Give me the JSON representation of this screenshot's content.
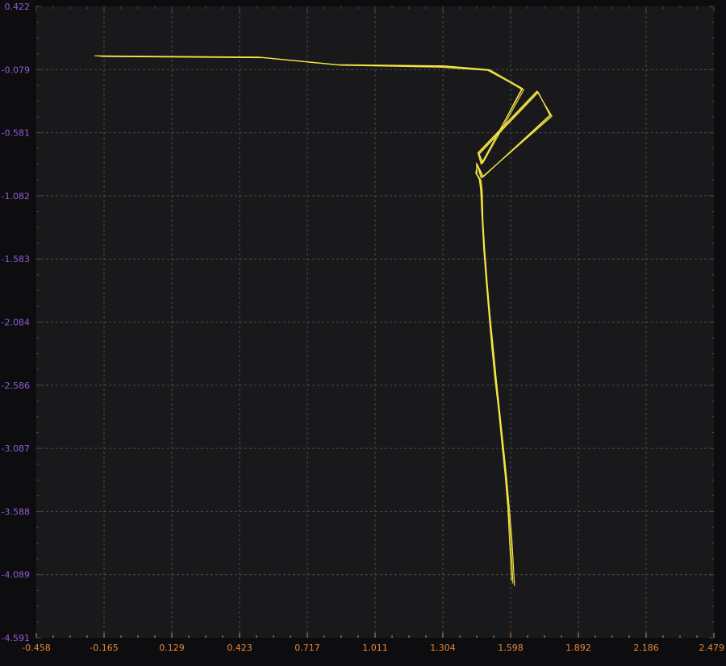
{
  "chart_data": {
    "type": "line",
    "title": "",
    "xlabel": "",
    "ylabel": "",
    "xlim": [
      -0.458,
      2.479
    ],
    "ylim": [
      -4.591,
      0.422
    ],
    "xticks": [
      "-0.458",
      "-0.165",
      "0.129",
      "0.423",
      "0.717",
      "1.011",
      "1.304",
      "1.598",
      "1.892",
      "2.186",
      "2.479"
    ],
    "yticks": [
      "0.422",
      "-0.079",
      "-0.581",
      "-1.082",
      "-1.583",
      "-2.084",
      "-2.586",
      "-3.087",
      "-3.588",
      "-4.089",
      "-4.591"
    ],
    "grid": true,
    "series": [
      {
        "x": [
          1.615,
          1.61,
          1.604,
          1.594,
          1.581,
          1.567,
          1.552,
          1.537,
          1.523,
          1.509,
          1.497,
          1.486,
          1.478,
          1.475,
          1.47,
          1.452,
          1.45,
          1.47,
          1.777,
          1.712,
          1.456,
          1.47,
          1.65,
          1.506,
          1.31,
          0.844,
          0.504,
          -0.206
        ],
        "y": [
          -4.18,
          -4.03,
          -3.82,
          -3.6,
          -3.33,
          -3.08,
          -2.82,
          -2.56,
          -2.3,
          -2.04,
          -1.78,
          -1.52,
          -1.28,
          -1.05,
          -0.96,
          -0.91,
          -0.82,
          -0.94,
          -0.45,
          -0.25,
          -0.74,
          -0.83,
          -0.23,
          -0.08,
          -0.05,
          -0.04,
          0.02,
          0.03
        ],
        "color": "#f5e642"
      },
      {
        "x": [
          1.602,
          1.598,
          1.592,
          1.586,
          1.574,
          1.56,
          1.546,
          1.53,
          1.516,
          1.504,
          1.492,
          1.481,
          1.474,
          1.468,
          1.462,
          1.447,
          1.454,
          1.48,
          1.768,
          1.718,
          1.462,
          1.478,
          1.655,
          1.498,
          1.295,
          0.862,
          0.525,
          -0.18
        ],
        "y": [
          -4.14,
          -3.98,
          -3.78,
          -3.56,
          -3.3,
          -3.05,
          -2.79,
          -2.54,
          -2.28,
          -2.02,
          -1.76,
          -1.5,
          -1.26,
          -1.03,
          -0.95,
          -0.9,
          -0.835,
          -0.93,
          -0.44,
          -0.26,
          -0.75,
          -0.82,
          -0.24,
          -0.085,
          -0.06,
          -0.045,
          0.015,
          0.025
        ],
        "color": "#f5e642"
      },
      {
        "x": [
          1.608,
          1.604,
          1.598,
          1.589,
          1.578,
          1.563,
          1.549,
          1.534,
          1.52,
          1.507,
          1.495,
          1.484,
          1.476,
          1.471,
          1.465,
          1.449,
          1.452,
          1.475,
          1.772,
          1.715,
          1.459,
          1.474,
          1.645,
          1.502,
          1.302,
          0.853,
          0.514,
          -0.193
        ],
        "y": [
          -4.16,
          -4.0,
          -3.8,
          -3.58,
          -3.31,
          -3.06,
          -2.8,
          -2.55,
          -2.29,
          -2.03,
          -1.77,
          -1.51,
          -1.27,
          -1.04,
          -0.955,
          -0.905,
          -0.828,
          -0.935,
          -0.445,
          -0.255,
          -0.745,
          -0.825,
          -0.235,
          -0.082,
          -0.055,
          -0.042,
          0.018,
          0.028
        ],
        "color": "#f5e642"
      }
    ],
    "colors": {
      "background": "#0d0d0f",
      "plot_background": "#19191c",
      "grid": "#4a4a4a",
      "x_tick_labels": "#e8863a",
      "y_tick_labels": "#8e5bd6",
      "axis_ticks": "#e8863a",
      "series": "#f5e642"
    }
  }
}
